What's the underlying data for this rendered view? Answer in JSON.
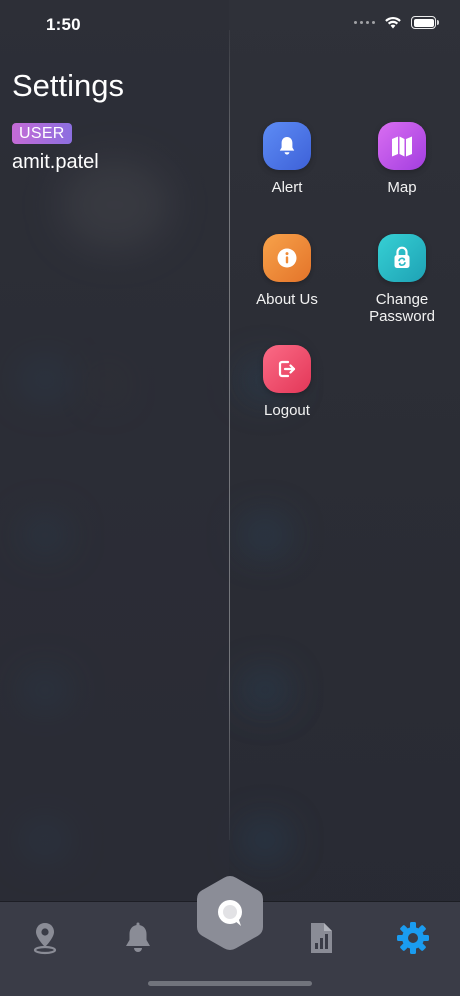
{
  "status_bar": {
    "time": "1:50",
    "icons": [
      "signal-icon",
      "wifi-icon",
      "battery-icon"
    ]
  },
  "header": {
    "title": "Settings",
    "role_badge": "USER",
    "username": "amit.patel"
  },
  "menu": {
    "items": [
      {
        "label": "Alert",
        "icon": "bell-icon",
        "color": "#4d74e8"
      },
      {
        "label": "Map",
        "icon": "map-icon",
        "color": "#c056ea"
      },
      {
        "label": "About Us",
        "icon": "info-icon",
        "color": "#ef8b38"
      },
      {
        "label": "Change\nPassword",
        "icon": "lock-refresh-icon",
        "color": "#2bb9c6"
      },
      {
        "label": "Logout",
        "icon": "logout-icon",
        "color": "#ef4e6e"
      }
    ]
  },
  "tabbar": {
    "tabs": [
      {
        "icon": "location-pin-icon",
        "active": false
      },
      {
        "icon": "bell-icon",
        "active": false
      },
      {
        "icon": "chat-hexagon-icon",
        "active": false
      },
      {
        "icon": "report-chart-icon",
        "active": false
      },
      {
        "icon": "gear-icon",
        "active": true
      }
    ],
    "active_color": "#1a9cf0",
    "inactive_color": "#8a8c96"
  }
}
